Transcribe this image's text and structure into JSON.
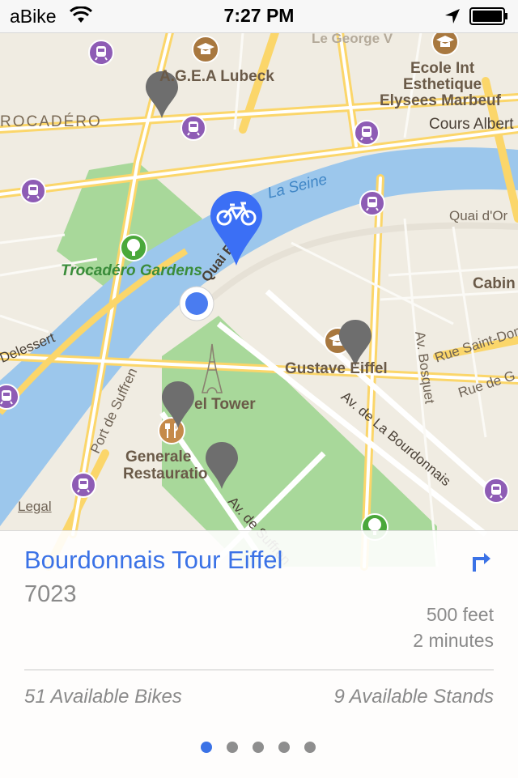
{
  "status_bar": {
    "carrier": "aBike",
    "time": "7:27 PM"
  },
  "map": {
    "labels": {
      "agea": "A.G.E.A Lubeck",
      "ecole_1": "Ecole Int",
      "ecole_2": "Esthetique",
      "ecole_3": "Elysees Marbeuf",
      "trocadero": "ROCADÉRO",
      "cours": "Cours Albert",
      "seine": "La Seine",
      "quai_dorsay": "Quai d'Or",
      "gardens": "Trocadéro Gardens",
      "quai_branly": "Quai Branly",
      "cabin": "Cabin",
      "delessert": "Delessert",
      "rue_st_dom": "Rue Saint-Dom",
      "av_bosquet": "Av. Bosquet",
      "rue_cler": "Rue de G",
      "gustave": "Gustave Eiffel",
      "tower": "el Tower",
      "port_suffren": "Port de Suffren",
      "av_bourdonnais": "Av. de La Bourdonnais",
      "generale_1": "Generale",
      "generale_2": "Restauratio",
      "av_suffren": "Av. de Suffren",
      "le_george": "Le George V"
    },
    "legal": "Legal"
  },
  "station": {
    "name": "Bourdonnais Tour Eiffel",
    "id": "7023",
    "distance": "500 feet",
    "duration": "2 minutes",
    "bikes": "51 Available Bikes",
    "stands": "9 Available Stands"
  },
  "pager": {
    "pages": 5,
    "active": 1
  },
  "colors": {
    "accent": "#3b72e6",
    "water": "#9cc7ec",
    "park": "#a8d89a",
    "road": "#fbd66a",
    "land": "#f0ece2"
  }
}
